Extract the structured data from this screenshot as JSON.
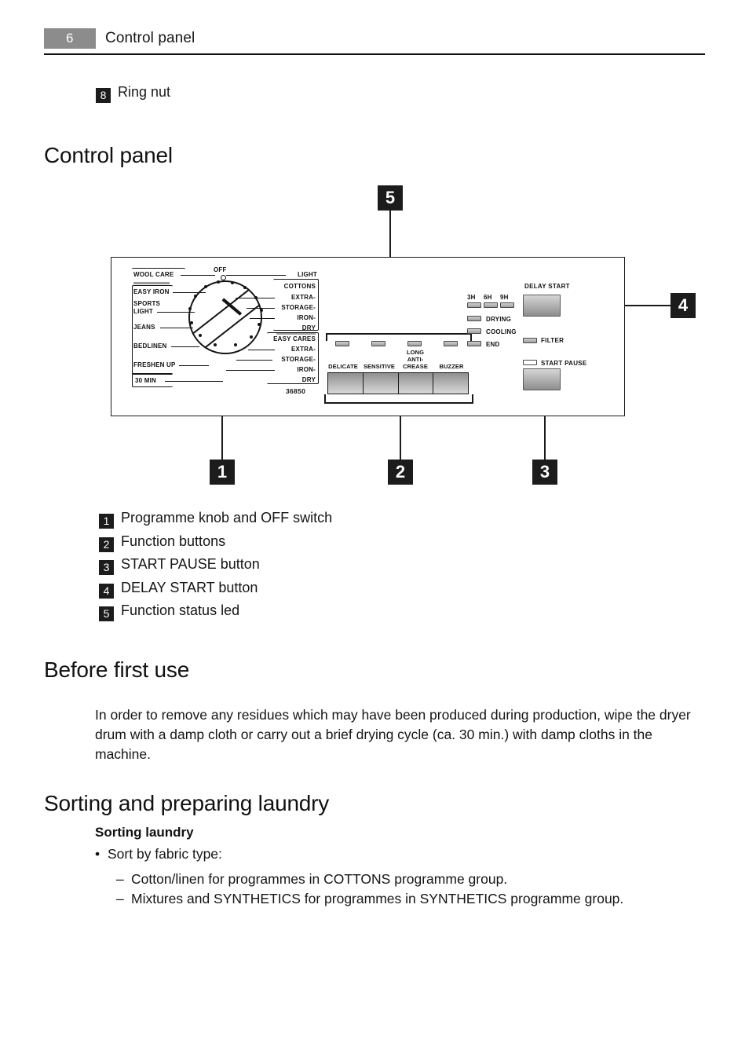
{
  "header": {
    "page_number": "6",
    "title": "Control panel"
  },
  "top_item": {
    "number": "8",
    "label": "Ring nut"
  },
  "headings": {
    "control_panel": "Control panel",
    "before_first_use": "Before first use",
    "sorting_and_preparing": "Sorting and preparing laundry"
  },
  "diagram": {
    "callouts": [
      {
        "number": "5"
      },
      {
        "number": "4"
      },
      {
        "number": "1"
      },
      {
        "number": "2"
      },
      {
        "number": "3"
      }
    ],
    "knob": {
      "off_label": "OFF",
      "left_labels": [
        "WOOL CARE",
        "EASY IRON",
        "SPORTS",
        "LIGHT",
        "JEANS",
        "BEDLINEN",
        "FRESHEN UP",
        "30 MIN"
      ],
      "right_top_label": "LIGHT",
      "cottons_group": {
        "title": "COTTONS",
        "items": [
          "EXTRA-",
          "STORAGE-",
          "IRON-",
          "DRY"
        ]
      },
      "easy_cares_group": {
        "title": "EASY CARES",
        "items": [
          "EXTRA-",
          "STORAGE-",
          "IRON-",
          "DRY"
        ]
      },
      "model_number": "36850"
    },
    "function_buttons": [
      {
        "label": "DELICATE",
        "led": "led-delicate"
      },
      {
        "label": "SENSITIVE",
        "led": "led-sensitive"
      },
      {
        "label": "LONG ANTI- CREASE",
        "label_line1": "LONG",
        "label_line2": "ANTI-",
        "label_line3": "CREASE",
        "led": "led-long-anti-crease"
      },
      {
        "label": "BUZZER",
        "led": "led-buzzer"
      }
    ],
    "status": {
      "hours": [
        "3H",
        "6H",
        "9H"
      ],
      "leds": [
        "DRYING",
        "COOLING",
        "END"
      ],
      "filter_label": "FILTER"
    },
    "buttons": {
      "delay_start": "DELAY START",
      "start_pause": "START  PAUSE"
    }
  },
  "legend": [
    {
      "number": "1",
      "label": "Programme knob and OFF switch"
    },
    {
      "number": "2",
      "label": "Function buttons"
    },
    {
      "number": "3",
      "label": "START PAUSE button"
    },
    {
      "number": "4",
      "label": "DELAY START button"
    },
    {
      "number": "5",
      "label": "Function status led"
    }
  ],
  "before_first_use": {
    "paragraph": "In order to remove any residues which may have been produced during production, wipe the dryer drum with a damp cloth or carry out a brief drying cycle (ca. 30 min.) with damp cloths in the machine."
  },
  "sorting": {
    "subheading": "Sorting laundry",
    "bullet": "Sort by fabric type:",
    "dashes": [
      "Cotton/linen for programmes in COTTONS programme group.",
      "Mixtures and SYNTHETICS for programmes in SYNTHETICS programme group."
    ]
  }
}
